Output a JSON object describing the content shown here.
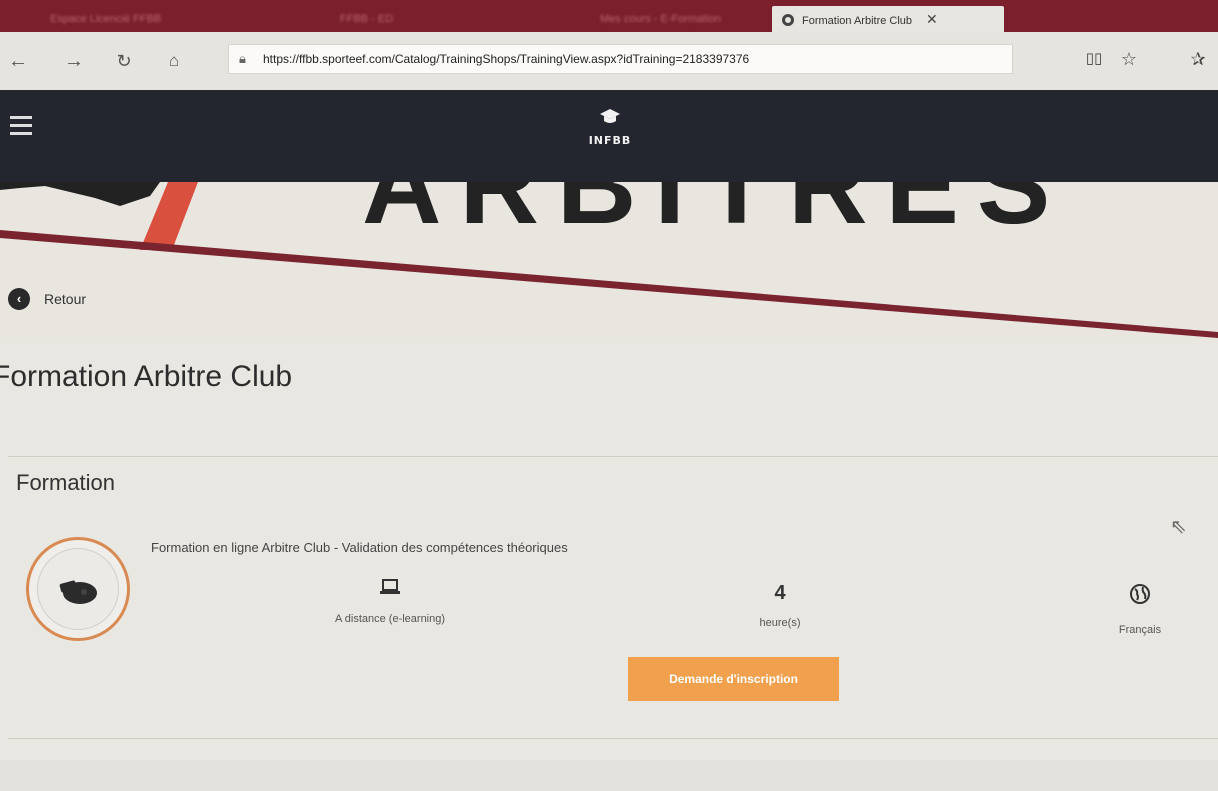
{
  "browser": {
    "tabs": [
      {
        "label": "Espace Licencié FFBB",
        "state": "inactive"
      },
      {
        "label": "FFBB - ED",
        "state": "inactive"
      },
      {
        "label": "Mes cours - E-Formation",
        "state": "inactive"
      },
      {
        "label": "Formation Arbitre Club",
        "state": "active"
      }
    ],
    "close_glyph": "✕",
    "url": "https://ffbb.sporteef.com/Catalog/TrainingShops/TrainingView.aspx?idTraining=2183397376",
    "icons": {
      "back": "back-arrow-icon",
      "forward": "forward-arrow-icon",
      "refresh": "refresh-icon",
      "home": "home-icon",
      "lock": "lock-icon",
      "reading_view": "reading-view-icon",
      "favorite": "star-icon",
      "favorites_hub": "favorites-hub-icon"
    }
  },
  "header": {
    "logo_text": "INFBB",
    "menu_icon": "hamburger-icon",
    "logo_icon": "graduation-cap-icon"
  },
  "banner": {
    "title": "ARBITRES"
  },
  "nav": {
    "back_label": "Retour"
  },
  "page": {
    "title": "Formation Arbitre Club"
  },
  "section": {
    "title": "Formation",
    "course": {
      "name": "Formation en ligne Arbitre Club - Validation des compétences théoriques",
      "mode_label": "A distance (e-learning)",
      "mode_icon": "laptop-icon",
      "duration_value": "4",
      "duration_unit": "heure(s)",
      "language_label": "Français",
      "language_icon": "globe-icon",
      "thumbnail_icon": "whistle-icon",
      "cta_label": "Demande d'inscription"
    }
  },
  "colors": {
    "tab_strip": "#7a1f2b",
    "header": "#23262e",
    "accent_line": "#7a2430",
    "cta": "#f1a14d",
    "icon_ring": "#d88a52"
  }
}
